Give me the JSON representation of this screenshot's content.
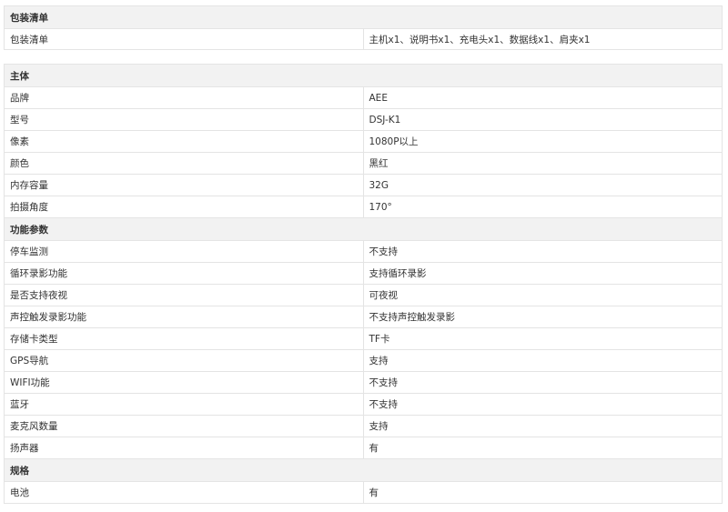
{
  "packing": {
    "title": "包装清单",
    "rows": [
      {
        "key": "包装清单",
        "value": "主机x1、说明书x1、充电头x1、数据线x1、肩夹x1"
      }
    ]
  },
  "main_body": {
    "title": "主体",
    "rows": [
      {
        "key": "品牌",
        "value": "AEE"
      },
      {
        "key": "型号",
        "value": "DSJ-K1"
      },
      {
        "key": "像素",
        "value": "1080P以上"
      },
      {
        "key": "颜色",
        "value": "黑红"
      },
      {
        "key": "内存容量",
        "value": "32G"
      },
      {
        "key": "拍摄角度",
        "value": "170°"
      }
    ]
  },
  "features": {
    "title": "功能参数",
    "rows": [
      {
        "key": "停车监测",
        "value": "不支持"
      },
      {
        "key": "循环录影功能",
        "value": "支持循环录影"
      },
      {
        "key": "是否支持夜视",
        "value": "可夜视"
      },
      {
        "key": "声控触发录影功能",
        "value": "不支持声控触发录影"
      },
      {
        "key": "存储卡类型",
        "value": "TF卡"
      },
      {
        "key": "GPS导航",
        "value": "支持"
      },
      {
        "key": "WIFI功能",
        "value": "不支持"
      },
      {
        "key": "蓝牙",
        "value": "不支持"
      },
      {
        "key": "麦克风数量",
        "value": "支持"
      },
      {
        "key": "扬声器",
        "value": "有"
      }
    ]
  },
  "specs": {
    "title": "规格",
    "rows": [
      {
        "key": "电池",
        "value": "有"
      }
    ]
  }
}
